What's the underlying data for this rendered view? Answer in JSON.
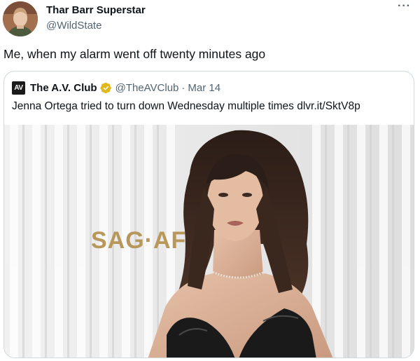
{
  "author": {
    "name": "Thar Barr Superstar",
    "handle": "@WildState"
  },
  "more_menu": "···",
  "tweet": {
    "text": "Me, when my alarm went off twenty minutes ago"
  },
  "quote": {
    "logo": "AV",
    "name": "The A.V. Club",
    "handle": "@TheAVClub",
    "separator": "·",
    "date": "Mar 14",
    "text": "Jenna Ortega tried to turn down Wednesday multiple times dlvr.it/SktV8p",
    "image_sign": "SAG·AF"
  },
  "colors": {
    "text": "#0f1419",
    "secondary": "#536471",
    "border": "#cfd9de",
    "verified_gold": "#e2b719"
  },
  "icons": {
    "verified": "verified-badge-icon",
    "more": "more-icon"
  }
}
